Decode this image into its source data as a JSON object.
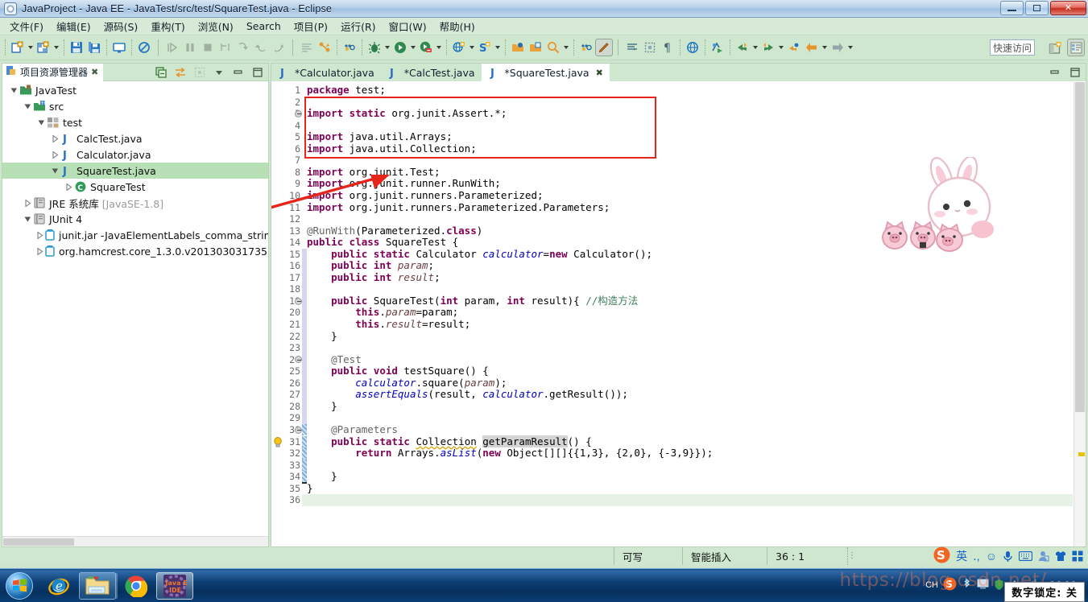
{
  "window": {
    "title": "JavaProject  -  Java EE  -  JavaTest/src/test/SquareTest.java  -  Eclipse",
    "app_icon": "eclipse-icon",
    "minimize_label": "—",
    "maximize_label": "❐",
    "close_label": "✕"
  },
  "menubar": {
    "items": [
      {
        "label": "文件(F)",
        "name": "menu-file"
      },
      {
        "label": "编辑(E)",
        "name": "menu-edit"
      },
      {
        "label": "源码(S)",
        "name": "menu-source"
      },
      {
        "label": "重构(T)",
        "name": "menu-refactor"
      },
      {
        "label": "浏览(N)",
        "name": "menu-navigate"
      },
      {
        "label": "Search",
        "name": "menu-search"
      },
      {
        "label": "项目(P)",
        "name": "menu-project"
      },
      {
        "label": "运行(R)",
        "name": "menu-run"
      },
      {
        "label": "窗口(W)",
        "name": "menu-window"
      },
      {
        "label": "帮助(H)",
        "name": "menu-help"
      }
    ]
  },
  "toolbar": {
    "quick_access_placeholder": "快速访问",
    "icons": [
      "new-wizard-icon",
      "new-wizard-dropdown",
      "new-java-project-icon",
      "new-project-dropdown",
      "save-icon",
      "save-all-icon",
      "print-icon",
      "skip-breakpoints-icon",
      "resume-icon",
      "suspend-icon",
      "terminate-icon",
      "step-into-icon",
      "step-over-icon",
      "step-return-icon",
      "disconnect-icon",
      "open-task-icon",
      "run-last-tool-icon",
      "external-tools-icon",
      "debug-icon",
      "debug-dropdown",
      "run-icon",
      "run-dropdown",
      "coverage-icon",
      "coverage-dropdown",
      "new-web-icon",
      "new-web-dropdown",
      "new-server-icon",
      "new-server-dropdown",
      "open-type-icon",
      "open-resource-icon",
      "search-icon",
      "search-dropdown",
      "more-icon",
      "toggle-mark-occurrences-icon",
      "next-annotation-icon",
      "previous-annotation-icon",
      "pilcrow-icon",
      "open-browser-icon",
      "profile-icon",
      "back-icon",
      "back-dropdown",
      "forward-icon",
      "forward-dropdown",
      "previous-edit-icon",
      "back-nav-icon",
      "back-nav-dropdown",
      "forward-nav-icon",
      "forward-nav-dropdown"
    ],
    "perspective_icons": [
      "open-perspective-icon",
      "java-ee-perspective-icon"
    ]
  },
  "explorer": {
    "tab_label": "项目资源管理器",
    "tab_icon": "package-explorer-icon",
    "close_icon": "✖",
    "view_tools": [
      "collapse-all-icon",
      "link-with-editor-icon",
      "focus-on-active-task-icon",
      "view-menu-icon",
      "minimize-icon",
      "maximize-icon"
    ],
    "tree": [
      {
        "label": "JavaTest",
        "indent": 0,
        "icon": "java-project-icon",
        "twisty": "open",
        "selected": false
      },
      {
        "label": "src",
        "indent": 1,
        "icon": "source-folder-icon",
        "twisty": "open",
        "selected": false
      },
      {
        "label": "test",
        "indent": 2,
        "icon": "package-icon",
        "twisty": "open",
        "selected": false
      },
      {
        "label": "CalcTest.java",
        "indent": 3,
        "icon": "java-file-icon",
        "twisty": "closed",
        "selected": false
      },
      {
        "label": "Calculator.java",
        "indent": 3,
        "icon": "java-file-icon",
        "twisty": "closed",
        "selected": false
      },
      {
        "label": "SquareTest.java",
        "indent": 3,
        "icon": "java-file-icon",
        "twisty": "open",
        "selected": true
      },
      {
        "label": "SquareTest",
        "indent": 4,
        "icon": "class-icon",
        "twisty": "closed",
        "selected": false
      },
      {
        "label": "JRE 系统库 [JavaSE-1.8]",
        "indent": 1,
        "icon": "library-icon",
        "twisty": "closed",
        "selected": false
      },
      {
        "label": "JUnit 4",
        "indent": 1,
        "icon": "library-icon",
        "twisty": "open",
        "selected": false
      },
      {
        "label": "junit.jar -JavaElementLabels_comma_string=",
        "indent": 2,
        "icon": "jar-icon",
        "twisty": "closed",
        "selected": false
      },
      {
        "label": "org.hamcrest.core_1.3.0.v201303031735.jar",
        "indent": 2,
        "icon": "jar-icon",
        "twisty": "closed",
        "selected": false
      }
    ]
  },
  "editor": {
    "tabs": [
      {
        "label": "*Calculator.java",
        "icon": "java-file-icon",
        "active": false,
        "closable": false
      },
      {
        "label": "*CalcTest.java",
        "icon": "java-file-icon",
        "active": false,
        "closable": false
      },
      {
        "label": "*SquareTest.java",
        "icon": "java-file-icon",
        "active": true,
        "closable": true
      }
    ],
    "close_icon": "✖",
    "view_tools": [
      "minimize-icon",
      "maximize-icon"
    ],
    "lines": [
      {
        "n": 1,
        "fold": false,
        "marker": "",
        "tokens": [
          [
            "kw",
            "package"
          ],
          [
            "pl",
            " test;"
          ]
        ]
      },
      {
        "n": 2,
        "fold": false,
        "marker": "",
        "tokens": []
      },
      {
        "n": 3,
        "fold": true,
        "marker": "",
        "tokens": [
          [
            "kw",
            "import static"
          ],
          [
            "pl",
            " org.junit.Assert.*;"
          ]
        ]
      },
      {
        "n": 4,
        "fold": false,
        "marker": "",
        "tokens": []
      },
      {
        "n": 5,
        "fold": false,
        "marker": "",
        "tokens": [
          [
            "kw",
            "import"
          ],
          [
            "pl",
            " java.util.Arrays;"
          ]
        ]
      },
      {
        "n": 6,
        "fold": false,
        "marker": "",
        "tokens": [
          [
            "kw",
            "import"
          ],
          [
            "pl",
            " java.util.Collection;"
          ]
        ]
      },
      {
        "n": 7,
        "fold": false,
        "marker": "",
        "tokens": []
      },
      {
        "n": 8,
        "fold": false,
        "marker": "",
        "tokens": [
          [
            "kw",
            "import"
          ],
          [
            "pl",
            " org.junit.Test;"
          ]
        ]
      },
      {
        "n": 9,
        "fold": false,
        "marker": "",
        "tokens": [
          [
            "kw",
            "import"
          ],
          [
            "pl",
            " org.junit.runner.RunWith;"
          ]
        ]
      },
      {
        "n": 10,
        "fold": false,
        "marker": "",
        "tokens": [
          [
            "kw",
            "import"
          ],
          [
            "pl",
            " org.junit.runners.Parameterized;"
          ]
        ]
      },
      {
        "n": 11,
        "fold": false,
        "marker": "",
        "tokens": [
          [
            "kw",
            "import"
          ],
          [
            "pl",
            " org.junit.runners.Parameterized.Parameters;"
          ]
        ]
      },
      {
        "n": 12,
        "fold": false,
        "marker": "",
        "tokens": []
      },
      {
        "n": 13,
        "fold": false,
        "marker": "",
        "tokens": [
          [
            "an",
            "@RunWith"
          ],
          [
            "pl",
            "(Parameterized."
          ],
          [
            "kw",
            "class"
          ],
          [
            "pl",
            ")"
          ]
        ]
      },
      {
        "n": 14,
        "fold": false,
        "marker": "",
        "tokens": [
          [
            "kw",
            "public class"
          ],
          [
            "pl",
            " SquareTest {"
          ]
        ]
      },
      {
        "n": 15,
        "fold": false,
        "marker": "",
        "tokens": [
          [
            "pl",
            "    "
          ],
          [
            "kw",
            "public static"
          ],
          [
            "pl",
            " Calculator "
          ],
          [
            "fi",
            "calculator"
          ],
          [
            "pl",
            "="
          ],
          [
            "kw",
            "new"
          ],
          [
            "pl",
            " Calculator();"
          ]
        ]
      },
      {
        "n": 16,
        "fold": false,
        "marker": "",
        "tokens": [
          [
            "pl",
            "    "
          ],
          [
            "kw",
            "public int"
          ],
          [
            "pl",
            " "
          ],
          [
            "sm",
            "param"
          ],
          [
            "pl",
            ";"
          ]
        ]
      },
      {
        "n": 17,
        "fold": false,
        "marker": "",
        "tokens": [
          [
            "pl",
            "    "
          ],
          [
            "kw",
            "public int"
          ],
          [
            "pl",
            " "
          ],
          [
            "sm",
            "result"
          ],
          [
            "pl",
            ";"
          ]
        ]
      },
      {
        "n": 18,
        "fold": false,
        "marker": "",
        "tokens": []
      },
      {
        "n": 19,
        "fold": true,
        "marker": "",
        "tokens": [
          [
            "pl",
            "    "
          ],
          [
            "kw",
            "public"
          ],
          [
            "pl",
            " SquareTest("
          ],
          [
            "kw",
            "int"
          ],
          [
            "pl",
            " param, "
          ],
          [
            "kw",
            "int"
          ],
          [
            "pl",
            " result){ "
          ],
          [
            "cm",
            "//构造方法"
          ]
        ]
      },
      {
        "n": 20,
        "fold": false,
        "marker": "",
        "tokens": [
          [
            "pl",
            "        "
          ],
          [
            "kw",
            "this"
          ],
          [
            "pl",
            "."
          ],
          [
            "sm",
            "param"
          ],
          [
            "pl",
            "=param;"
          ]
        ]
      },
      {
        "n": 21,
        "fold": false,
        "marker": "",
        "tokens": [
          [
            "pl",
            "        "
          ],
          [
            "kw",
            "this"
          ],
          [
            "pl",
            "."
          ],
          [
            "sm",
            "result"
          ],
          [
            "pl",
            "=result;"
          ]
        ]
      },
      {
        "n": 22,
        "fold": false,
        "marker": "",
        "tokens": [
          [
            "pl",
            "    }"
          ]
        ]
      },
      {
        "n": 23,
        "fold": false,
        "marker": "",
        "tokens": []
      },
      {
        "n": 24,
        "fold": true,
        "marker": "",
        "tokens": [
          [
            "pl",
            "    "
          ],
          [
            "an",
            "@Test"
          ]
        ]
      },
      {
        "n": 25,
        "fold": false,
        "marker": "",
        "tokens": [
          [
            "pl",
            "    "
          ],
          [
            "kw",
            "public void"
          ],
          [
            "pl",
            " testSquare() {"
          ]
        ]
      },
      {
        "n": 26,
        "fold": false,
        "marker": "",
        "tokens": [
          [
            "pl",
            "        "
          ],
          [
            "fi",
            "calculator"
          ],
          [
            "pl",
            ".square("
          ],
          [
            "sm",
            "param"
          ],
          [
            "pl",
            ");"
          ]
        ]
      },
      {
        "n": 27,
        "fold": false,
        "marker": "",
        "tokens": [
          [
            "pl",
            "        "
          ],
          [
            "fi",
            "assertEquals"
          ],
          [
            "pl",
            "(result, "
          ],
          [
            "fi",
            "calculator"
          ],
          [
            "pl",
            ".getResult());"
          ]
        ]
      },
      {
        "n": 28,
        "fold": false,
        "marker": "",
        "tokens": [
          [
            "pl",
            "    }"
          ]
        ]
      },
      {
        "n": 29,
        "fold": false,
        "marker": "",
        "tokens": []
      },
      {
        "n": 30,
        "fold": true,
        "marker": "",
        "tokens": [
          [
            "pl",
            "    "
          ],
          [
            "an",
            "@Parameters"
          ]
        ]
      },
      {
        "n": 31,
        "fold": false,
        "marker": "bulb",
        "tokens": [
          [
            "pl",
            "    "
          ],
          [
            "kw",
            "public static"
          ],
          [
            "pl",
            " "
          ],
          [
            "wavy",
            "Collection"
          ],
          [
            "pl",
            " "
          ],
          [
            "hl",
            "getParamResult"
          ],
          [
            "pl",
            "() {"
          ]
        ]
      },
      {
        "n": 32,
        "fold": false,
        "marker": "",
        "tokens": [
          [
            "pl",
            "        "
          ],
          [
            "kw",
            "return"
          ],
          [
            "pl",
            " Arrays."
          ],
          [
            "fi",
            "asList"
          ],
          [
            "pl",
            "("
          ],
          [
            "kw",
            "new"
          ],
          [
            "pl",
            " Object[][]{{1,3}, {2,0}, {-3,9}});"
          ]
        ]
      },
      {
        "n": 33,
        "fold": false,
        "marker": "",
        "tokens": []
      },
      {
        "n": 34,
        "fold": false,
        "marker": "",
        "tokens": [
          [
            "pl",
            "    }"
          ]
        ]
      },
      {
        "n": 35,
        "fold": false,
        "marker": "",
        "tokens": [
          [
            "pl",
            "}"
          ]
        ]
      },
      {
        "n": 36,
        "fold": false,
        "marker": "",
        "tokens": []
      }
    ],
    "annotations": {
      "red_box_name": "red-highlight-box",
      "red_arrow_name": "red-annotation-arrow"
    },
    "decoration_icon": "bunny-with-pigs-sticker"
  },
  "statusbar": {
    "writable": "可写",
    "insert_mode": "智能插入",
    "cursor_position": "36 : 1"
  },
  "ime": {
    "logo": "sogou-logo-icon",
    "mode": "英",
    "icons": [
      "punctuation-icon",
      "emoji-icon",
      "voice-input-icon",
      "soft-keyboard-icon",
      "user-icon",
      "skin-icon",
      "toolbox-icon"
    ]
  },
  "taskbar": {
    "start_label": "start-orb-icon",
    "buttons": [
      {
        "name": "taskbar-internet-explorer",
        "icon": "internet-explorer-icon",
        "state": "normal"
      },
      {
        "name": "taskbar-file-explorer",
        "icon": "file-explorer-icon",
        "state": "grouped"
      },
      {
        "name": "taskbar-chrome",
        "icon": "chrome-icon",
        "state": "normal"
      },
      {
        "name": "taskbar-eclipse",
        "icon": "java-ee-ide-icon",
        "state": "active",
        "badge": "Java EE IDE"
      }
    ],
    "tray_icons": [
      "keyboard-layout-ch",
      "sogou-tray-icon",
      "bluetooth-icon",
      "vmware-tray-icon",
      "shield-icon",
      "volume-icon",
      "network-icon"
    ],
    "clock_time": "16:18",
    "numlock_tooltip": "数字锁定: 关",
    "watermark": "https://blog.csdn.net/..."
  },
  "colors": {
    "accent_green": "#cfe7cf",
    "selection_green": "#b7e0b7",
    "keyword_purple": "#7f0055",
    "annotation_gray": "#646464",
    "comment_green": "#3f7f5f",
    "field_blue": "#0000c0",
    "red_annotation": "#e8251b",
    "titlebar_blue": "#b6cfe8"
  }
}
